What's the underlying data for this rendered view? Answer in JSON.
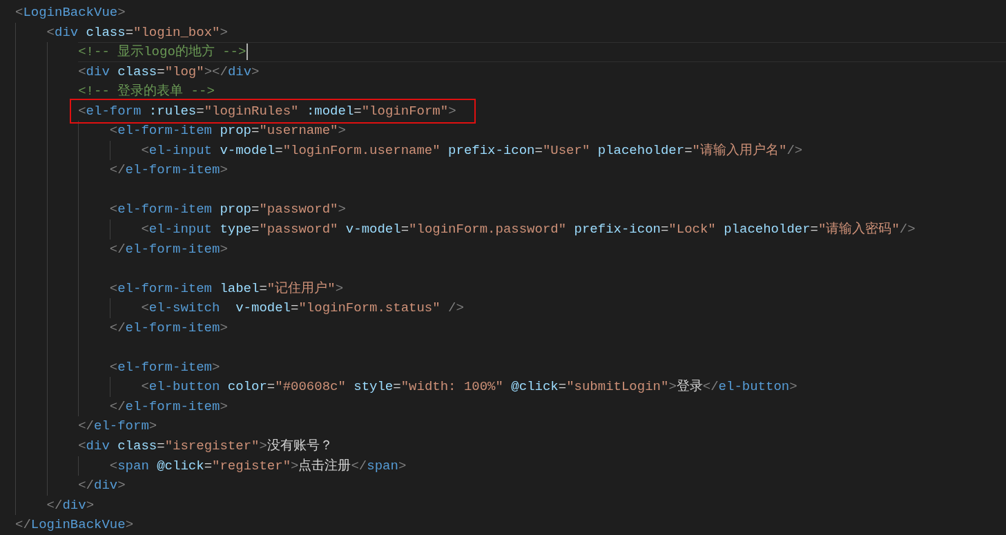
{
  "editor": {
    "lines": [
      {
        "kind": "code",
        "current": false,
        "boxed": false,
        "tokens": [
          {
            "kind": "bracket",
            "text": "<"
          },
          {
            "kind": "tag",
            "text": "LoginBackVue"
          },
          {
            "kind": "bracket",
            "text": ">"
          }
        ],
        "children": [
          {
            "kind": "code",
            "current": false,
            "boxed": false,
            "tokens": [
              {
                "kind": "bracket",
                "text": "<"
              },
              {
                "kind": "tag",
                "text": "div"
              },
              {
                "kind": "attr",
                "text": " class"
              },
              {
                "kind": "op",
                "text": "="
              },
              {
                "kind": "string",
                "text": "\"login_box\""
              },
              {
                "kind": "bracket",
                "text": ">"
              }
            ],
            "children": [
              {
                "kind": "code",
                "current": true,
                "boxed": false,
                "tokens": [
                  {
                    "kind": "comment",
                    "text": "<!-- 显示logo的地方 -->"
                  }
                ]
              },
              {
                "kind": "code",
                "current": false,
                "boxed": false,
                "tokens": [
                  {
                    "kind": "bracket",
                    "text": "<"
                  },
                  {
                    "kind": "tag",
                    "text": "div"
                  },
                  {
                    "kind": "attr",
                    "text": " class"
                  },
                  {
                    "kind": "op",
                    "text": "="
                  },
                  {
                    "kind": "string",
                    "text": "\"log\""
                  },
                  {
                    "kind": "bracket",
                    "text": "></"
                  },
                  {
                    "kind": "tag",
                    "text": "div"
                  },
                  {
                    "kind": "bracket",
                    "text": ">"
                  }
                ]
              },
              {
                "kind": "code",
                "current": false,
                "boxed": false,
                "tokens": [
                  {
                    "kind": "comment",
                    "text": "<!-- 登录的表单 -->"
                  }
                ]
              },
              {
                "kind": "code",
                "current": false,
                "boxed": true,
                "tokens": [
                  {
                    "kind": "bracket",
                    "text": "<"
                  },
                  {
                    "kind": "tag",
                    "text": "el-form"
                  },
                  {
                    "kind": "attr",
                    "text": " :rules"
                  },
                  {
                    "kind": "op",
                    "text": "="
                  },
                  {
                    "kind": "string",
                    "text": "\"loginRules\""
                  },
                  {
                    "kind": "attr",
                    "text": " :model"
                  },
                  {
                    "kind": "op",
                    "text": "="
                  },
                  {
                    "kind": "string",
                    "text": "\"loginForm\""
                  },
                  {
                    "kind": "bracket",
                    "text": ">"
                  }
                ],
                "children": [
                  {
                    "kind": "code",
                    "current": false,
                    "boxed": false,
                    "tokens": [
                      {
                        "kind": "bracket",
                        "text": "<"
                      },
                      {
                        "kind": "tag",
                        "text": "el-form-item"
                      },
                      {
                        "kind": "attr",
                        "text": " prop"
                      },
                      {
                        "kind": "op",
                        "text": "="
                      },
                      {
                        "kind": "string",
                        "text": "\"username\""
                      },
                      {
                        "kind": "bracket",
                        "text": ">"
                      }
                    ],
                    "children": [
                      {
                        "kind": "code",
                        "current": false,
                        "boxed": false,
                        "tokens": [
                          {
                            "kind": "bracket",
                            "text": "<"
                          },
                          {
                            "kind": "tag",
                            "text": "el-input"
                          },
                          {
                            "kind": "attr",
                            "text": " v-model"
                          },
                          {
                            "kind": "op",
                            "text": "="
                          },
                          {
                            "kind": "string",
                            "text": "\"loginForm.username\""
                          },
                          {
                            "kind": "attr",
                            "text": " prefix-icon"
                          },
                          {
                            "kind": "op",
                            "text": "="
                          },
                          {
                            "kind": "string",
                            "text": "\"User\""
                          },
                          {
                            "kind": "attr",
                            "text": " placeholder"
                          },
                          {
                            "kind": "op",
                            "text": "="
                          },
                          {
                            "kind": "string",
                            "text": "\"请输入用户名\""
                          },
                          {
                            "kind": "bracket",
                            "text": "/>"
                          }
                        ]
                      }
                    ]
                  },
                  {
                    "kind": "code",
                    "current": false,
                    "boxed": false,
                    "tokens": [
                      {
                        "kind": "bracket",
                        "text": "</"
                      },
                      {
                        "kind": "tag",
                        "text": "el-form-item"
                      },
                      {
                        "kind": "bracket",
                        "text": ">"
                      }
                    ]
                  },
                  {
                    "kind": "blank",
                    "current": false,
                    "boxed": false
                  },
                  {
                    "kind": "code",
                    "current": false,
                    "boxed": false,
                    "tokens": [
                      {
                        "kind": "bracket",
                        "text": "<"
                      },
                      {
                        "kind": "tag",
                        "text": "el-form-item"
                      },
                      {
                        "kind": "attr",
                        "text": " prop"
                      },
                      {
                        "kind": "op",
                        "text": "="
                      },
                      {
                        "kind": "string",
                        "text": "\"password\""
                      },
                      {
                        "kind": "bracket",
                        "text": ">"
                      }
                    ],
                    "children": [
                      {
                        "kind": "code",
                        "current": false,
                        "boxed": false,
                        "tokens": [
                          {
                            "kind": "bracket",
                            "text": "<"
                          },
                          {
                            "kind": "tag",
                            "text": "el-input"
                          },
                          {
                            "kind": "attr",
                            "text": " type"
                          },
                          {
                            "kind": "op",
                            "text": "="
                          },
                          {
                            "kind": "string",
                            "text": "\"password\""
                          },
                          {
                            "kind": "attr",
                            "text": " v-model"
                          },
                          {
                            "kind": "op",
                            "text": "="
                          },
                          {
                            "kind": "string",
                            "text": "\"loginForm.password\""
                          },
                          {
                            "kind": "attr",
                            "text": " prefix-icon"
                          },
                          {
                            "kind": "op",
                            "text": "="
                          },
                          {
                            "kind": "string",
                            "text": "\"Lock\""
                          },
                          {
                            "kind": "attr",
                            "text": " placeholder"
                          },
                          {
                            "kind": "op",
                            "text": "="
                          },
                          {
                            "kind": "string",
                            "text": "\"请输入密码\""
                          },
                          {
                            "kind": "bracket",
                            "text": "/>"
                          }
                        ]
                      }
                    ]
                  },
                  {
                    "kind": "code",
                    "current": false,
                    "boxed": false,
                    "tokens": [
                      {
                        "kind": "bracket",
                        "text": "</"
                      },
                      {
                        "kind": "tag",
                        "text": "el-form-item"
                      },
                      {
                        "kind": "bracket",
                        "text": ">"
                      }
                    ]
                  },
                  {
                    "kind": "blank",
                    "current": false,
                    "boxed": false
                  },
                  {
                    "kind": "code",
                    "current": false,
                    "boxed": false,
                    "tokens": [
                      {
                        "kind": "bracket",
                        "text": "<"
                      },
                      {
                        "kind": "tag",
                        "text": "el-form-item"
                      },
                      {
                        "kind": "attr",
                        "text": " label"
                      },
                      {
                        "kind": "op",
                        "text": "="
                      },
                      {
                        "kind": "string",
                        "text": "\"记住用户\""
                      },
                      {
                        "kind": "bracket",
                        "text": ">"
                      }
                    ],
                    "children": [
                      {
                        "kind": "code",
                        "current": false,
                        "boxed": false,
                        "tokens": [
                          {
                            "kind": "bracket",
                            "text": "<"
                          },
                          {
                            "kind": "tag",
                            "text": "el-switch"
                          },
                          {
                            "kind": "attr",
                            "text": "  v-model"
                          },
                          {
                            "kind": "op",
                            "text": "="
                          },
                          {
                            "kind": "string",
                            "text": "\"loginForm.status\""
                          },
                          {
                            "kind": "bracket",
                            "text": " />"
                          }
                        ]
                      }
                    ]
                  },
                  {
                    "kind": "code",
                    "current": false,
                    "boxed": false,
                    "tokens": [
                      {
                        "kind": "bracket",
                        "text": "</"
                      },
                      {
                        "kind": "tag",
                        "text": "el-form-item"
                      },
                      {
                        "kind": "bracket",
                        "text": ">"
                      }
                    ]
                  },
                  {
                    "kind": "blank",
                    "current": false,
                    "boxed": false
                  },
                  {
                    "kind": "code",
                    "current": false,
                    "boxed": false,
                    "tokens": [
                      {
                        "kind": "bracket",
                        "text": "<"
                      },
                      {
                        "kind": "tag",
                        "text": "el-form-item"
                      },
                      {
                        "kind": "bracket",
                        "text": ">"
                      }
                    ],
                    "children": [
                      {
                        "kind": "code",
                        "current": false,
                        "boxed": false,
                        "tokens": [
                          {
                            "kind": "bracket",
                            "text": "<"
                          },
                          {
                            "kind": "tag",
                            "text": "el-button"
                          },
                          {
                            "kind": "attr",
                            "text": " color"
                          },
                          {
                            "kind": "op",
                            "text": "="
                          },
                          {
                            "kind": "string",
                            "text": "\"#00608c\""
                          },
                          {
                            "kind": "attr",
                            "text": " style"
                          },
                          {
                            "kind": "op",
                            "text": "="
                          },
                          {
                            "kind": "string",
                            "text": "\"width: 100%\""
                          },
                          {
                            "kind": "attr",
                            "text": " @click"
                          },
                          {
                            "kind": "op",
                            "text": "="
                          },
                          {
                            "kind": "string",
                            "text": "\"submitLogin\""
                          },
                          {
                            "kind": "bracket",
                            "text": ">"
                          },
                          {
                            "kind": "text",
                            "text": "登录"
                          },
                          {
                            "kind": "bracket",
                            "text": "</"
                          },
                          {
                            "kind": "tag",
                            "text": "el-button"
                          },
                          {
                            "kind": "bracket",
                            "text": ">"
                          }
                        ]
                      }
                    ]
                  },
                  {
                    "kind": "code",
                    "current": false,
                    "boxed": false,
                    "tokens": [
                      {
                        "kind": "bracket",
                        "text": "</"
                      },
                      {
                        "kind": "tag",
                        "text": "el-form-item"
                      },
                      {
                        "kind": "bracket",
                        "text": ">"
                      }
                    ]
                  }
                ]
              },
              {
                "kind": "code",
                "current": false,
                "boxed": false,
                "tokens": [
                  {
                    "kind": "bracket",
                    "text": "</"
                  },
                  {
                    "kind": "tag",
                    "text": "el-form"
                  },
                  {
                    "kind": "bracket",
                    "text": ">"
                  }
                ]
              },
              {
                "kind": "code",
                "current": false,
                "boxed": false,
                "tokens": [
                  {
                    "kind": "bracket",
                    "text": "<"
                  },
                  {
                    "kind": "tag",
                    "text": "div"
                  },
                  {
                    "kind": "attr",
                    "text": " class"
                  },
                  {
                    "kind": "op",
                    "text": "="
                  },
                  {
                    "kind": "string",
                    "text": "\"isregister\""
                  },
                  {
                    "kind": "bracket",
                    "text": ">"
                  },
                  {
                    "kind": "text",
                    "text": "没有账号？"
                  }
                ],
                "children": [
                  {
                    "kind": "code",
                    "current": false,
                    "boxed": false,
                    "tokens": [
                      {
                        "kind": "bracket",
                        "text": "<"
                      },
                      {
                        "kind": "tag",
                        "text": "span"
                      },
                      {
                        "kind": "attr",
                        "text": " @click"
                      },
                      {
                        "kind": "op",
                        "text": "="
                      },
                      {
                        "kind": "string",
                        "text": "\"register\""
                      },
                      {
                        "kind": "bracket",
                        "text": ">"
                      },
                      {
                        "kind": "text",
                        "text": "点击注册"
                      },
                      {
                        "kind": "bracket",
                        "text": "</"
                      },
                      {
                        "kind": "tag",
                        "text": "span"
                      },
                      {
                        "kind": "bracket",
                        "text": ">"
                      }
                    ]
                  }
                ]
              },
              {
                "kind": "code",
                "current": false,
                "boxed": false,
                "tokens": [
                  {
                    "kind": "bracket",
                    "text": "</"
                  },
                  {
                    "kind": "tag",
                    "text": "div"
                  },
                  {
                    "kind": "bracket",
                    "text": ">"
                  }
                ]
              }
            ]
          },
          {
            "kind": "code",
            "current": false,
            "boxed": false,
            "tokens": [
              {
                "kind": "bracket",
                "text": "</"
              },
              {
                "kind": "tag",
                "text": "div"
              },
              {
                "kind": "bracket",
                "text": ">"
              }
            ]
          }
        ]
      },
      {
        "kind": "code",
        "current": false,
        "boxed": false,
        "tokens": [
          {
            "kind": "bracket",
            "text": "</"
          },
          {
            "kind": "tag",
            "text": "LoginBackVue"
          },
          {
            "kind": "bracket",
            "text": ">"
          }
        ]
      }
    ]
  }
}
